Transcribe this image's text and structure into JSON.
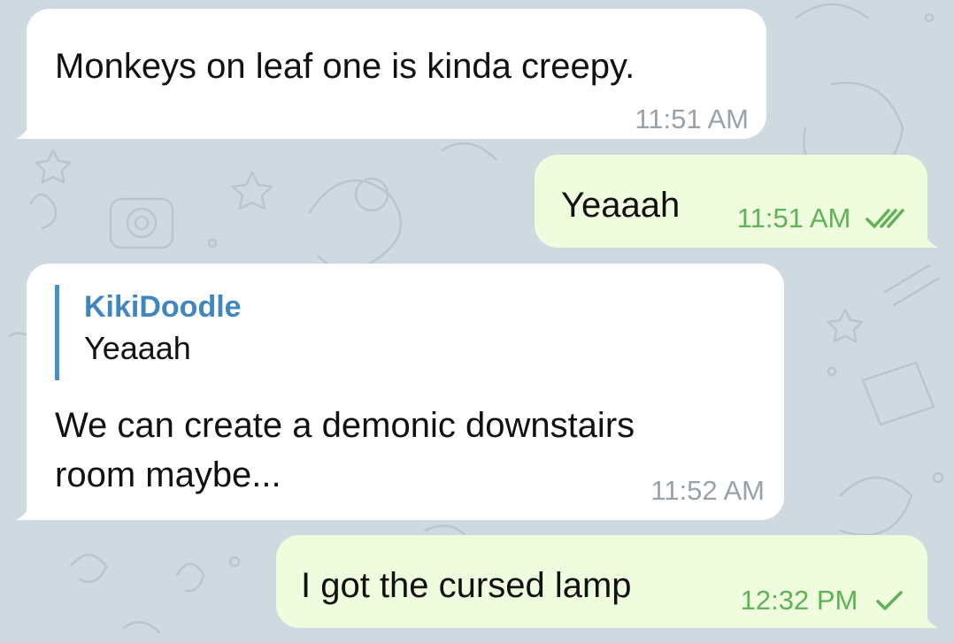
{
  "colors": {
    "background": "#cfd9e0",
    "incoming_bubble": "#ffffff",
    "outgoing_bubble": "#effdde",
    "incoming_time": "#9aa2a8",
    "outgoing_time": "#5fb255",
    "reply_accent": "#4a90c8"
  },
  "messages": [
    {
      "direction": "incoming",
      "text": "Monkeys on leaf one is kinda creepy.",
      "time": "11:51 AM"
    },
    {
      "direction": "outgoing",
      "text": "Yeaaah",
      "time": "11:51 AM",
      "status_icon": "double-check-icon"
    },
    {
      "direction": "incoming",
      "reply": {
        "author": "KikiDoodle",
        "text": "Yeaaah"
      },
      "text_line1": "We can create a demonic downstairs",
      "text_line2": "room maybe...",
      "time": "11:52 AM"
    },
    {
      "direction": "outgoing",
      "text": "I got the cursed lamp",
      "time": "12:32 PM",
      "status_icon": "single-check-icon"
    }
  ]
}
